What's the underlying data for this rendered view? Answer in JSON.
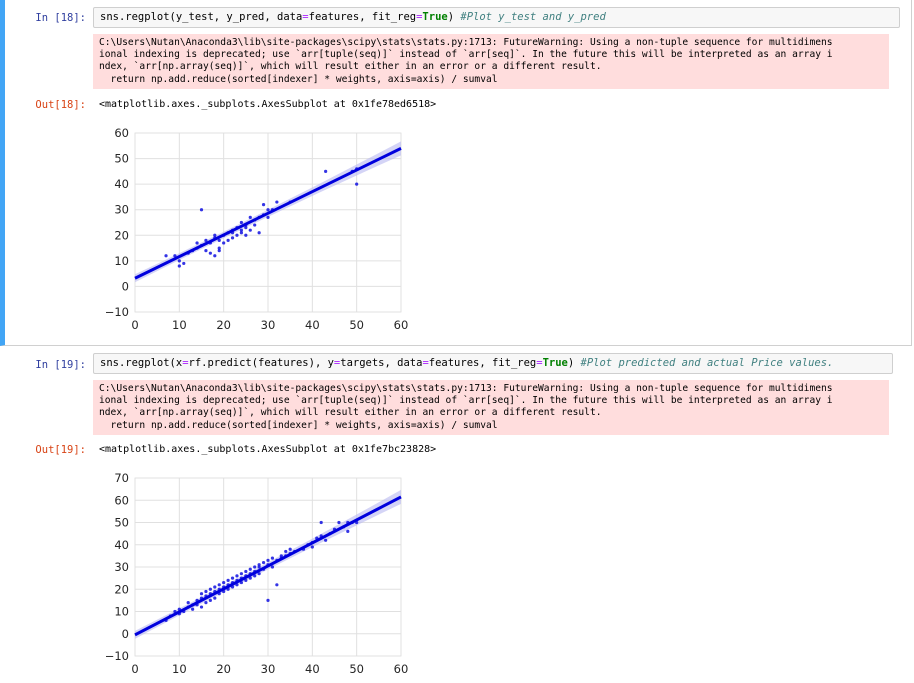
{
  "cells": [
    {
      "in_prompt": "In [18]:",
      "code_main": "sns.regplot(y_test, y_pred, data",
      "code_eq": "=",
      "code_mid": "features, fit_reg",
      "code_eq2": "=",
      "code_kw": "True",
      "code_close": ") ",
      "code_comment": "#Plot y_test and y_pred",
      "warning": [
        "C:\\Users\\Nutan\\Anaconda3\\lib\\site-packages\\scipy\\stats\\stats.py:1713: FutureWarning: Using a non-tuple sequence for multidimens",
        "ional indexing is deprecated; use `arr[tuple(seq)]` instead of `arr[seq]`. In the future this will be interpreted as an array i",
        "ndex, `arr[np.array(seq)]`, which will result either in an error or a different result.",
        "  return np.add.reduce(sorted[indexer] * weights, axis=axis) / sumval"
      ],
      "out_prompt": "Out[18]:",
      "out_text": "<matplotlib.axes._subplots.AxesSubplot at 0x1fe78ed6518>"
    },
    {
      "in_prompt": "In [19]:",
      "code_main": "sns.regplot(x",
      "code_eq": "=",
      "code_mid": "rf.predict(features), y",
      "code_eq2": "=",
      "code_mid2": "targets, data",
      "code_eq3": "=",
      "code_mid3": "features, fit_reg",
      "code_eq4": "=",
      "code_kw": "True",
      "code_close": ") ",
      "code_comment": "#Plot predicted and actual Price values.",
      "warning": [
        "C:\\Users\\Nutan\\Anaconda3\\lib\\site-packages\\scipy\\stats\\stats.py:1713: FutureWarning: Using a non-tuple sequence for multidimens",
        "ional indexing is deprecated; use `arr[tuple(seq)]` instead of `arr[seq]`. In the future this will be interpreted as an array i",
        "ndex, `arr[np.array(seq)]`, which will result either in an error or a different result.",
        "  return np.add.reduce(sorted[indexer] * weights, axis=axis) / sumval"
      ],
      "out_prompt": "Out[19]:",
      "out_text": "<matplotlib.axes._subplots.AxesSubplot at 0x1fe7bc23828>"
    }
  ],
  "colors": {
    "point": "#1010e0",
    "line": "#0000dd",
    "band": "#b8b8f0",
    "grid": "#e0e0e0",
    "stderr_bg": "#ffdddd"
  },
  "chart_data": [
    {
      "type": "scatter",
      "regression_line": {
        "x0": 0,
        "y0": 3.2,
        "x1": 60,
        "y1": 54,
        "confidence_band": true
      },
      "xticks": [
        "0",
        "10",
        "20",
        "30",
        "40",
        "50",
        "60"
      ],
      "yticks": [
        "60",
        "50",
        "40",
        "30",
        "20",
        "10",
        "0",
        "−10"
      ],
      "xlim": [
        0,
        60
      ],
      "ylim": [
        -10,
        60
      ],
      "grid": true,
      "points": [
        [
          7,
          12
        ],
        [
          9,
          12
        ],
        [
          10,
          10
        ],
        [
          10,
          8
        ],
        [
          11,
          9
        ],
        [
          12,
          13
        ],
        [
          13,
          14
        ],
        [
          14,
          15
        ],
        [
          14,
          17
        ],
        [
          15,
          30
        ],
        [
          15,
          16
        ],
        [
          16,
          14
        ],
        [
          16,
          18
        ],
        [
          17,
          13
        ],
        [
          17,
          17
        ],
        [
          18,
          19
        ],
        [
          18,
          12
        ],
        [
          18,
          20
        ],
        [
          19,
          14
        ],
        [
          19,
          18
        ],
        [
          19,
          15
        ],
        [
          20,
          20
        ],
        [
          20,
          17
        ],
        [
          21,
          21
        ],
        [
          21,
          18
        ],
        [
          22,
          22
        ],
        [
          22,
          19
        ],
        [
          22,
          21
        ],
        [
          23,
          20
        ],
        [
          23,
          23
        ],
        [
          24,
          22
        ],
        [
          24,
          21
        ],
        [
          24,
          25
        ],
        [
          25,
          23
        ],
        [
          25,
          20
        ],
        [
          25,
          24
        ],
        [
          26,
          27
        ],
        [
          26,
          22
        ],
        [
          27,
          26
        ],
        [
          27,
          24
        ],
        [
          28,
          21
        ],
        [
          28,
          27
        ],
        [
          29,
          32
        ],
        [
          29,
          28
        ],
        [
          30,
          30
        ],
        [
          30,
          27
        ],
        [
          31,
          30
        ],
        [
          32,
          33
        ],
        [
          35,
          33
        ],
        [
          43,
          45
        ],
        [
          49,
          45
        ],
        [
          50,
          40
        ],
        [
          50,
          46
        ]
      ]
    },
    {
      "type": "scatter",
      "regression_line": {
        "x0": 0,
        "y0": -0.5,
        "x1": 60,
        "y1": 61.5,
        "confidence_band": true
      },
      "xticks": [
        "0",
        "10",
        "20",
        "30",
        "40",
        "50",
        "60"
      ],
      "yticks": [
        "70",
        "60",
        "50",
        "40",
        "30",
        "20",
        "10",
        "0",
        "−10"
      ],
      "xlim": [
        0,
        60
      ],
      "ylim": [
        -10,
        70
      ],
      "grid": true,
      "points": [
        [
          7,
          6
        ],
        [
          8,
          8
        ],
        [
          9,
          10
        ],
        [
          10,
          9
        ],
        [
          10,
          11
        ],
        [
          11,
          10
        ],
        [
          12,
          12
        ],
        [
          12,
          14
        ],
        [
          13,
          13
        ],
        [
          13,
          11
        ],
        [
          14,
          15
        ],
        [
          14,
          13
        ],
        [
          15,
          16
        ],
        [
          15,
          12
        ],
        [
          15,
          18
        ],
        [
          16,
          14
        ],
        [
          16,
          17
        ],
        [
          16,
          19
        ],
        [
          17,
          15
        ],
        [
          17,
          18
        ],
        [
          17,
          20
        ],
        [
          18,
          16
        ],
        [
          18,
          19
        ],
        [
          18,
          21
        ],
        [
          19,
          18
        ],
        [
          19,
          22
        ],
        [
          19,
          20
        ],
        [
          20,
          19
        ],
        [
          20,
          21
        ],
        [
          20,
          23
        ],
        [
          21,
          20
        ],
        [
          21,
          22
        ],
        [
          21,
          24
        ],
        [
          22,
          21
        ],
        [
          22,
          23
        ],
        [
          22,
          25
        ],
        [
          23,
          22
        ],
        [
          23,
          24
        ],
        [
          23,
          26
        ],
        [
          24,
          23
        ],
        [
          24,
          25
        ],
        [
          24,
          27
        ],
        [
          25,
          24
        ],
        [
          25,
          26
        ],
        [
          25,
          28
        ],
        [
          26,
          25
        ],
        [
          26,
          27
        ],
        [
          26,
          29
        ],
        [
          27,
          26
        ],
        [
          27,
          28
        ],
        [
          27,
          30
        ],
        [
          28,
          27
        ],
        [
          28,
          30
        ],
        [
          28,
          31
        ],
        [
          29,
          29
        ],
        [
          29,
          32
        ],
        [
          30,
          15
        ],
        [
          30,
          31
        ],
        [
          30,
          33
        ],
        [
          31,
          30
        ],
        [
          31,
          34
        ],
        [
          32,
          22
        ],
        [
          32,
          33
        ],
        [
          33,
          34
        ],
        [
          33,
          35
        ],
        [
          34,
          35
        ],
        [
          34,
          37
        ],
        [
          35,
          36
        ],
        [
          35,
          38
        ],
        [
          36,
          37
        ],
        [
          38,
          38
        ],
        [
          39,
          40
        ],
        [
          40,
          41
        ],
        [
          40,
          39
        ],
        [
          41,
          43
        ],
        [
          42,
          44
        ],
        [
          42,
          50
        ],
        [
          43,
          42
        ],
        [
          44,
          45
        ],
        [
          45,
          47
        ],
        [
          46,
          50
        ],
        [
          47,
          48
        ],
        [
          48,
          50
        ],
        [
          49,
          50
        ],
        [
          50,
          50
        ],
        [
          48,
          46
        ]
      ]
    }
  ]
}
